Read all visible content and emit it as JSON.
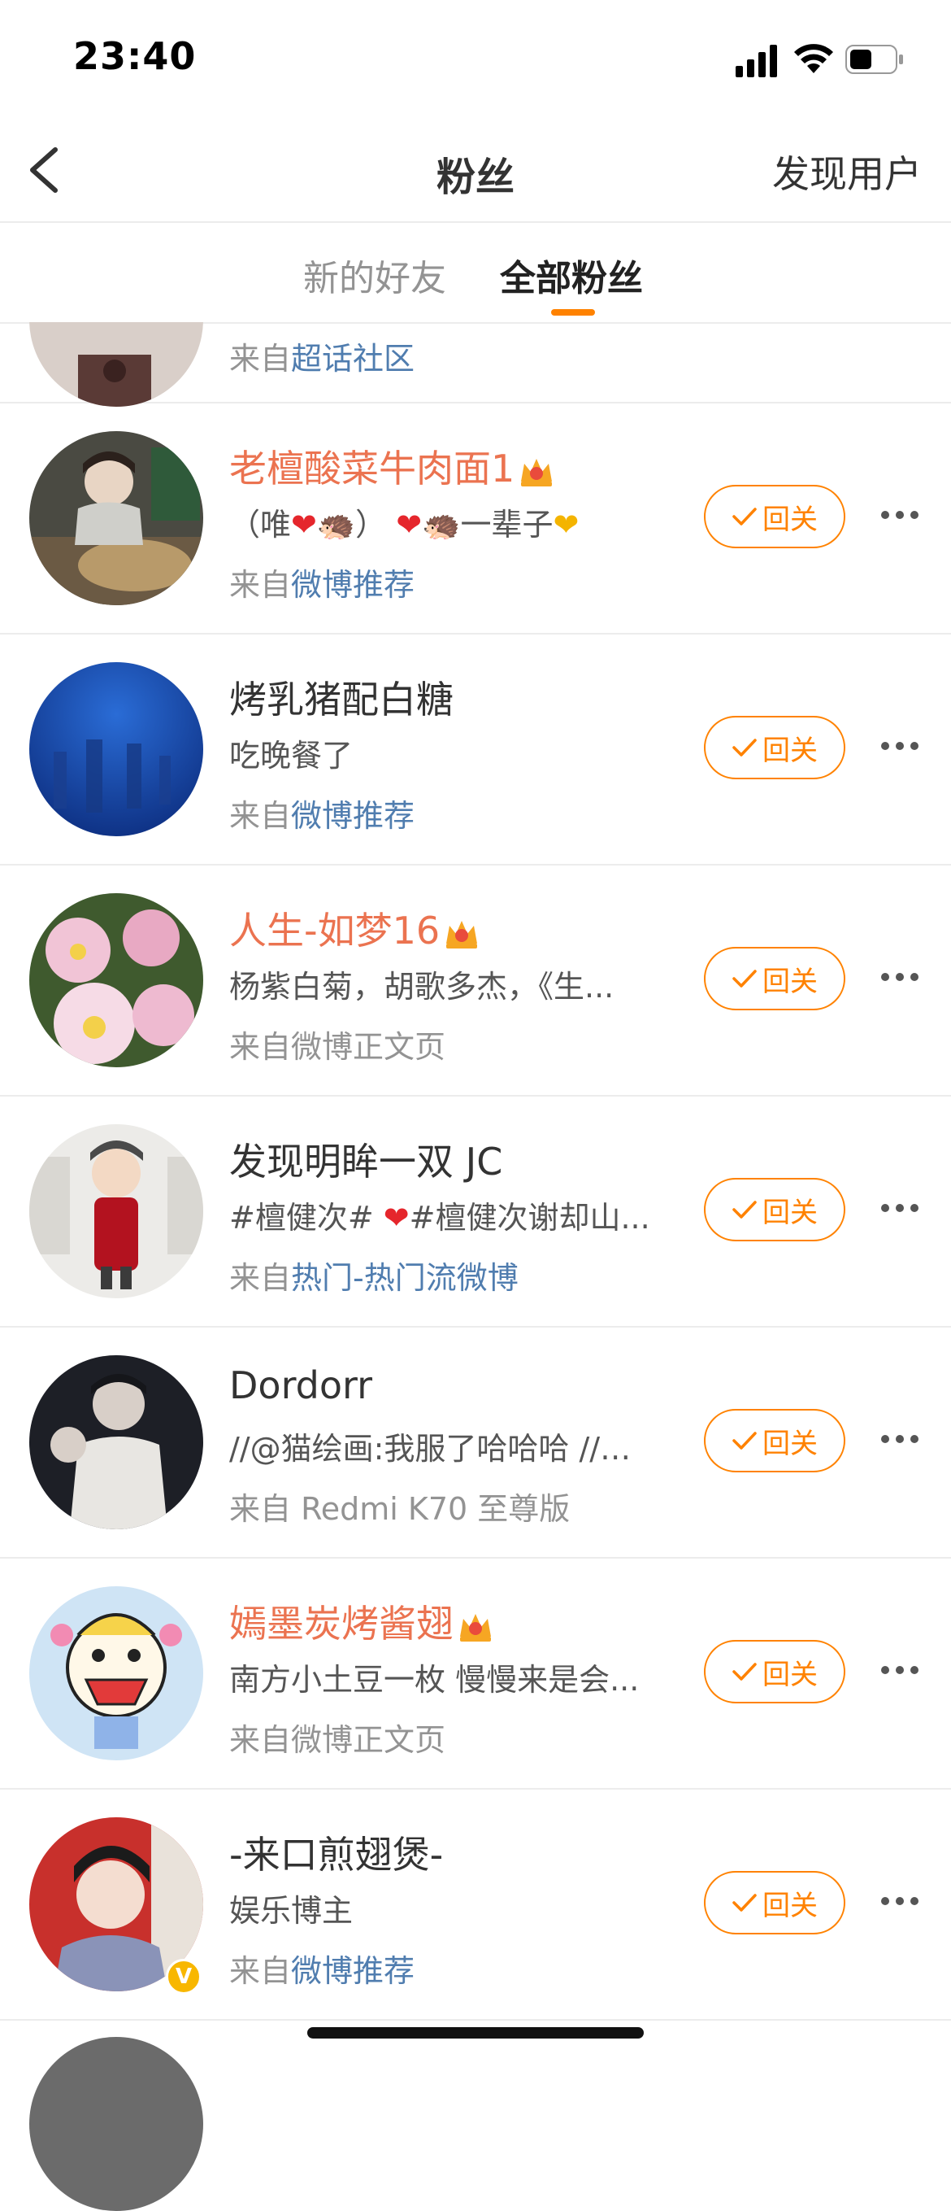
{
  "status_bar": {
    "time": "23:40"
  },
  "nav": {
    "back_icon": "chevron-left-icon",
    "title": "粉丝",
    "right_action": "发现用户"
  },
  "tabs": [
    {
      "label": "新的好友",
      "active": false
    },
    {
      "label": "全部粉丝",
      "active": true
    }
  ],
  "top_partial": {
    "source_prefix": "来自",
    "source_link": "超话社区"
  },
  "follow_label": "回关",
  "rows": [
    {
      "name": "老檀酸菜牛肉面1",
      "vip": true,
      "bio_a": "（唯",
      "bio_b": "🦔）",
      "bio_c": "🦔一辈子",
      "source_prefix": "来自",
      "source_link": "微博推荐",
      "linked": true
    },
    {
      "name": "烤乳猪配白糖",
      "vip": false,
      "bio": "吃晚餐了",
      "source_prefix": "来自",
      "source_link": "微博推荐",
      "linked": true
    },
    {
      "name": "人生-如梦16",
      "vip": true,
      "bio": "杨紫白菊，胡歌多杰，《生...",
      "source_prefix": "来自微博正文页",
      "source_link": "",
      "linked": false
    },
    {
      "name": "发现明眸一双 JC",
      "vip": false,
      "bio_a": "#檀健次# ",
      "bio_b": "#檀健次谢却山...",
      "source_prefix": "来自",
      "source_link": "热门-热门流微博",
      "linked": true
    },
    {
      "name": "Dordorr",
      "vip": false,
      "bio": "//@猫绘画:我服了哈哈哈 //@...",
      "source_prefix": "来自 Redmi K70 至尊版",
      "source_link": "",
      "linked": false
    },
    {
      "name": "嫣墨炭烤酱翅",
      "vip": true,
      "bio": "南方小土豆一枚 慢慢来是会...",
      "source_prefix": "来自微博正文页",
      "source_link": "",
      "linked": false
    },
    {
      "name": "-来口煎翅煲-",
      "vip": false,
      "bio": "娱乐博主",
      "source_prefix": "来自",
      "source_link": "微博推荐",
      "linked": true,
      "verified_badge": "V"
    }
  ]
}
